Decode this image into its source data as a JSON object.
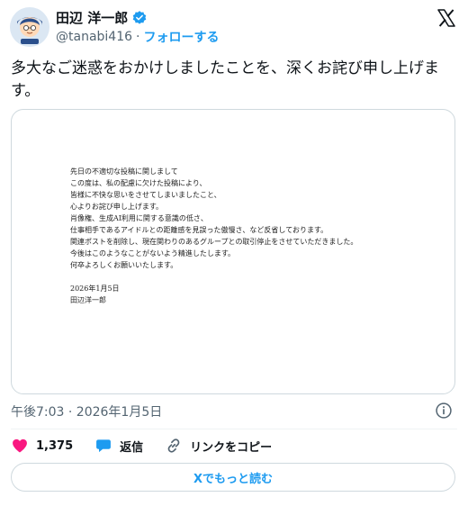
{
  "author": {
    "display_name": "田辺 洋一郎",
    "handle": "@tanabi416",
    "separator": "·",
    "follow_label": "フォローする"
  },
  "tweet": {
    "text": "多大なご迷惑をおかけしましたことを、深くお詫び申し上げます。"
  },
  "document": {
    "lines": [
      "先日の不適切な投稿に関しまして",
      "この度は、私の配慮に欠けた投稿により、",
      "皆様に不快な思いをさせてしまいましたこと、",
      "心よりお詫び申し上げます。",
      "肖像権、生成AI利用に関する意識の低さ、",
      "仕事相手であるアイドルとの距離感を見誤った傲慢さ、など反省しております。",
      "関連ポストを削除し、現在関わりのあるグループとの取引停止をさせていただきました。",
      "今後はこのようなことがないよう精進したします。",
      "何卒よろしくお願いいたします。"
    ],
    "date": "2026年1月5日",
    "signature": "田辺洋一郎"
  },
  "meta": {
    "timestamp": "午後7:03 · 2026年1月5日"
  },
  "actions": {
    "likes": "1,375",
    "reply_label": "返信",
    "copy_link_label": "リンクをコピー"
  },
  "read_more_label": "Xでもっと読む",
  "colors": {
    "accent": "#1d9bf0",
    "like": "#f91880",
    "text": "#0f1419",
    "secondary": "#536471"
  }
}
